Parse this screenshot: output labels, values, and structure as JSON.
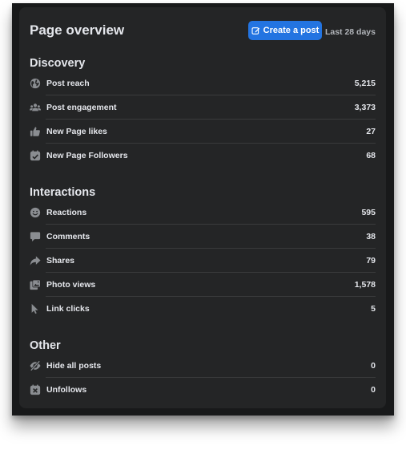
{
  "header": {
    "title": "Page overview",
    "create_post_label": "Create a post",
    "date_range": "Last 28 days"
  },
  "discovery": {
    "title": "Discovery",
    "rows": [
      {
        "label": "Post reach",
        "value": "5,215",
        "icon": "globe-icon"
      },
      {
        "label": "Post engagement",
        "value": "3,373",
        "icon": "people-icon"
      },
      {
        "label": "New Page likes",
        "value": "27",
        "icon": "thumbs-up-icon"
      },
      {
        "label": "New Page Followers",
        "value": "68",
        "icon": "follow-check-icon"
      }
    ]
  },
  "interactions": {
    "title": "Interactions",
    "rows": [
      {
        "label": "Reactions",
        "value": "595",
        "icon": "smiley-icon"
      },
      {
        "label": "Comments",
        "value": "38",
        "icon": "comment-icon"
      },
      {
        "label": "Shares",
        "value": "79",
        "icon": "share-arrow-icon"
      },
      {
        "label": "Photo views",
        "value": "1,578",
        "icon": "photos-icon"
      },
      {
        "label": "Link clicks",
        "value": "5",
        "icon": "cursor-icon"
      }
    ]
  },
  "other": {
    "title": "Other",
    "rows": [
      {
        "label": "Hide all posts",
        "value": "0",
        "icon": "eye-slash-icon"
      },
      {
        "label": "Unfollows",
        "value": "0",
        "icon": "unfollow-x-icon"
      }
    ]
  },
  "colors": {
    "background": "#242526",
    "accent": "#2374e1",
    "text_primary": "#e4e6eb",
    "text_secondary": "#b0b3b8",
    "icon": "#8a8d91"
  }
}
